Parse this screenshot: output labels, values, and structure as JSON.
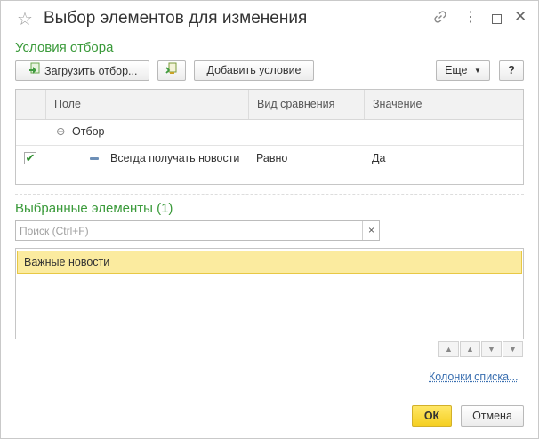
{
  "window": {
    "title": "Выбор элементов для изменения",
    "star_icon": "☆",
    "link_icon": "🔗",
    "menu_icon": "⋮",
    "close_icon": "✕"
  },
  "filter_section": {
    "title": "Условия отбора",
    "load_button": "Загрузить отбор...",
    "add_condition_button": "Добавить условие",
    "more_button": "Еще",
    "help_button": "?"
  },
  "filter_table": {
    "columns": [
      "Поле",
      "Вид сравнения",
      "Значение"
    ],
    "group_row": {
      "expander": "⊖",
      "label": "Отбор"
    },
    "rows": [
      {
        "checked": "✔",
        "field": "Всегда получать новости",
        "comparison": "Равно",
        "value": "Да"
      }
    ]
  },
  "selected_section": {
    "title": "Выбранные элементы (1)",
    "search_placeholder": "Поиск (Ctrl+F)",
    "clear_icon": "×",
    "items": [
      "Важные новости"
    ],
    "move_buttons": [
      "▲",
      "▲",
      "▼",
      "▼"
    ]
  },
  "footer": {
    "columns_link": "Колонки списка...",
    "ok_button": "ОК",
    "cancel_button": "Отмена"
  },
  "colors": {
    "accent_green": "#3a9a3a",
    "selected_row": "#fbeb9f",
    "ok_yellow": "#f5cf21",
    "link_blue": "#3a6fb0"
  }
}
